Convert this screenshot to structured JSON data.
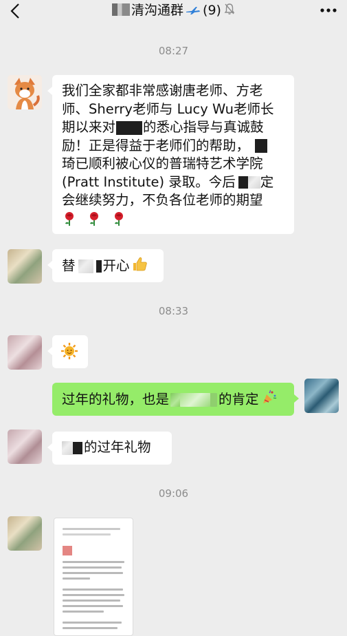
{
  "header": {
    "title": "清沟通群",
    "member_count": "(9)"
  },
  "timestamps": [
    "08:27",
    "08:33",
    "09:06"
  ],
  "messages": {
    "m1": {
      "l1": "我们全家都非常感谢唐老师、方老",
      "l2": "师、Sherry老师与 Lucy Wu老师长",
      "l3a": "期以来对",
      "l3b": "的悉心指导与真诚鼓",
      "l4a": "励！正是得益于老师们的帮助，",
      "l5": "琦已顺利被心仪的普瑞特艺术学院",
      "l6a": "(Pratt Institute) 录取。今后",
      "l6b": "定",
      "l7": "会继续努力，不负各位老师的期望"
    },
    "m2": {
      "a": "替",
      "b": "开心"
    },
    "m4": {
      "a": "过年的礼物，也是",
      "b": "的肯定"
    },
    "m5": {
      "a": "的过年礼物"
    }
  },
  "icons": {
    "back": "chevron-left-icon",
    "more": "more-dots-icon",
    "mute": "bell-muted-icon",
    "plane": "airplane-icon"
  },
  "colors": {
    "background": "#ededed",
    "bubble_in": "#ffffff",
    "bubble_out": "#95ec69",
    "timestamp": "#8c8c8c"
  }
}
